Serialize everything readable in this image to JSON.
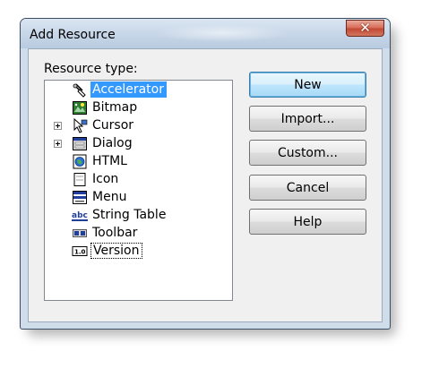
{
  "window": {
    "title": "Add Resource",
    "close_glyph": "✕"
  },
  "resource_type_label": "Resource type:",
  "resources": [
    {
      "label": "Accelerator",
      "icon": "accelerator-icon",
      "expandable": false,
      "selected": true
    },
    {
      "label": "Bitmap",
      "icon": "bitmap-icon",
      "expandable": false
    },
    {
      "label": "Cursor",
      "icon": "cursor-icon",
      "expandable": true
    },
    {
      "label": "Dialog",
      "icon": "dialog-icon",
      "expandable": true
    },
    {
      "label": "HTML",
      "icon": "html-icon",
      "expandable": false
    },
    {
      "label": "Icon",
      "icon": "icon-resource-icon",
      "expandable": false
    },
    {
      "label": "Menu",
      "icon": "menu-icon",
      "expandable": false
    },
    {
      "label": "String Table",
      "icon": "string-table-icon",
      "icon_text": "abc",
      "expandable": false
    },
    {
      "label": "Toolbar",
      "icon": "toolbar-icon",
      "expandable": false
    },
    {
      "label": "Version",
      "icon": "version-icon",
      "icon_text": "1.0",
      "expandable": false,
      "focused": true
    }
  ],
  "buttons": {
    "new": "New",
    "import": "Import...",
    "custom": "Custom...",
    "cancel": "Cancel",
    "help": "Help"
  },
  "colors": {
    "selection": "#3399ff",
    "frame": "#cfdcea",
    "close_button": "#c24a34"
  }
}
